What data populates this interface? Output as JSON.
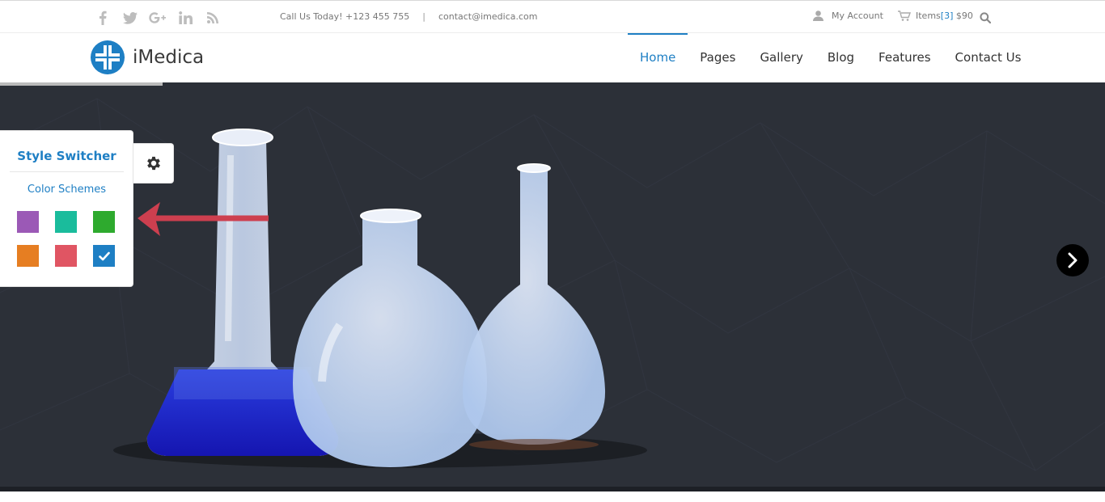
{
  "topbar": {
    "social_icons": [
      "facebook-icon",
      "twitter-icon",
      "google-plus-icon",
      "linkedin-icon",
      "rss-icon"
    ],
    "phone": "Call Us Today! +123 455 755",
    "separator": "|",
    "email": "contact@imedica.com",
    "account": "My Account",
    "cart_prefix": "Items",
    "cart_count": "[3]",
    "cart_total": "$90"
  },
  "brand": {
    "name": "iMedica",
    "color": "#1e7fc4"
  },
  "nav": [
    {
      "label": "Home",
      "active": true
    },
    {
      "label": "Pages"
    },
    {
      "label": "Gallery"
    },
    {
      "label": "Blog"
    },
    {
      "label": "Features"
    },
    {
      "label": "Contact Us"
    }
  ],
  "slider": {
    "progress": 0.147
  },
  "style_switcher": {
    "title": "Style Switcher",
    "subtitle": "Color Schemes",
    "swatches": [
      {
        "color": "#9b59b6"
      },
      {
        "color": "#1abc9c"
      },
      {
        "color": "#2eaa2e"
      },
      {
        "color": "#e67e22"
      },
      {
        "color": "#e05563"
      },
      {
        "color": "#1e7fc4",
        "selected": true
      }
    ]
  }
}
